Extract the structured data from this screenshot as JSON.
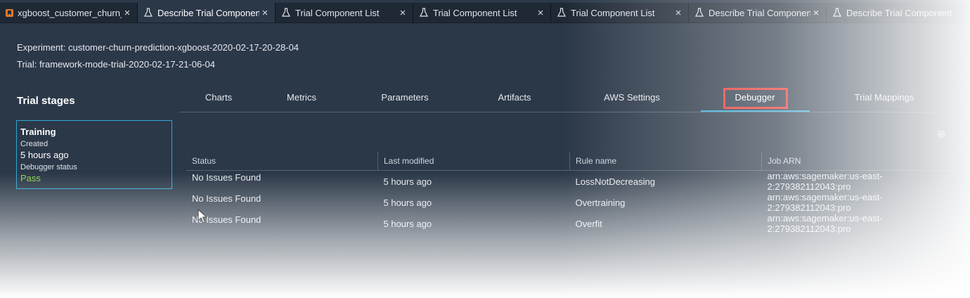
{
  "tabs": [
    {
      "label": "xgboost_customer_churn_",
      "icon": "notebook-bookmark-icon",
      "active": false
    },
    {
      "label": "Describe Trial Component",
      "icon": "flask-icon",
      "active": true
    },
    {
      "label": "Trial Component List",
      "icon": "flask-icon",
      "active": false
    },
    {
      "label": "Trial Component List",
      "icon": "flask-icon",
      "active": false
    },
    {
      "label": "Trial Component List",
      "icon": "flask-icon",
      "active": false
    },
    {
      "label": "Describe Trial Component",
      "icon": "flask-icon",
      "active": false
    },
    {
      "label": "Describe Trial Component",
      "icon": "flask-icon",
      "active": false
    }
  ],
  "header": {
    "experiment": "Experiment: customer-churn-prediction-xgboost-2020-02-17-20-28-04",
    "trial": "Trial: framework-mode-trial-2020-02-17-21-06-04"
  },
  "stages": {
    "title": "Trial stages",
    "card": {
      "name": "Training",
      "created_label": "Created",
      "created_value": "5 hours ago",
      "debugger_label": "Debugger status",
      "debugger_value": "Pass"
    }
  },
  "subtabs": [
    {
      "label": "Charts"
    },
    {
      "label": "Metrics"
    },
    {
      "label": "Parameters"
    },
    {
      "label": "Artifacts"
    },
    {
      "label": "AWS Settings"
    },
    {
      "label": "Debugger",
      "active": true
    },
    {
      "label": "Trial Mappings"
    }
  ],
  "table": {
    "columns": [
      "Status",
      "Last modified",
      "Rule name",
      "Job ARN"
    ],
    "rows": [
      {
        "status": "No Issues Found",
        "modified": "5 hours ago",
        "rule": "LossNotDecreasing",
        "arn": "arn:aws:sagemaker:us-east-2:279382112043:pro"
      },
      {
        "status": "No Issues Found",
        "modified": "5 hours ago",
        "rule": "Overtraining",
        "arn": "arn:aws:sagemaker:us-east-2:279382112043:pro"
      },
      {
        "status": "No Issues Found",
        "modified": "5 hours ago",
        "rule": "Overfit",
        "arn": "arn:aws:sagemaker:us-east-2:279382112043:pro"
      }
    ]
  },
  "colors": {
    "background": "#2b3848",
    "accent": "#2fa7d6",
    "success": "#8fd14f",
    "highlight": "#e8342e"
  }
}
